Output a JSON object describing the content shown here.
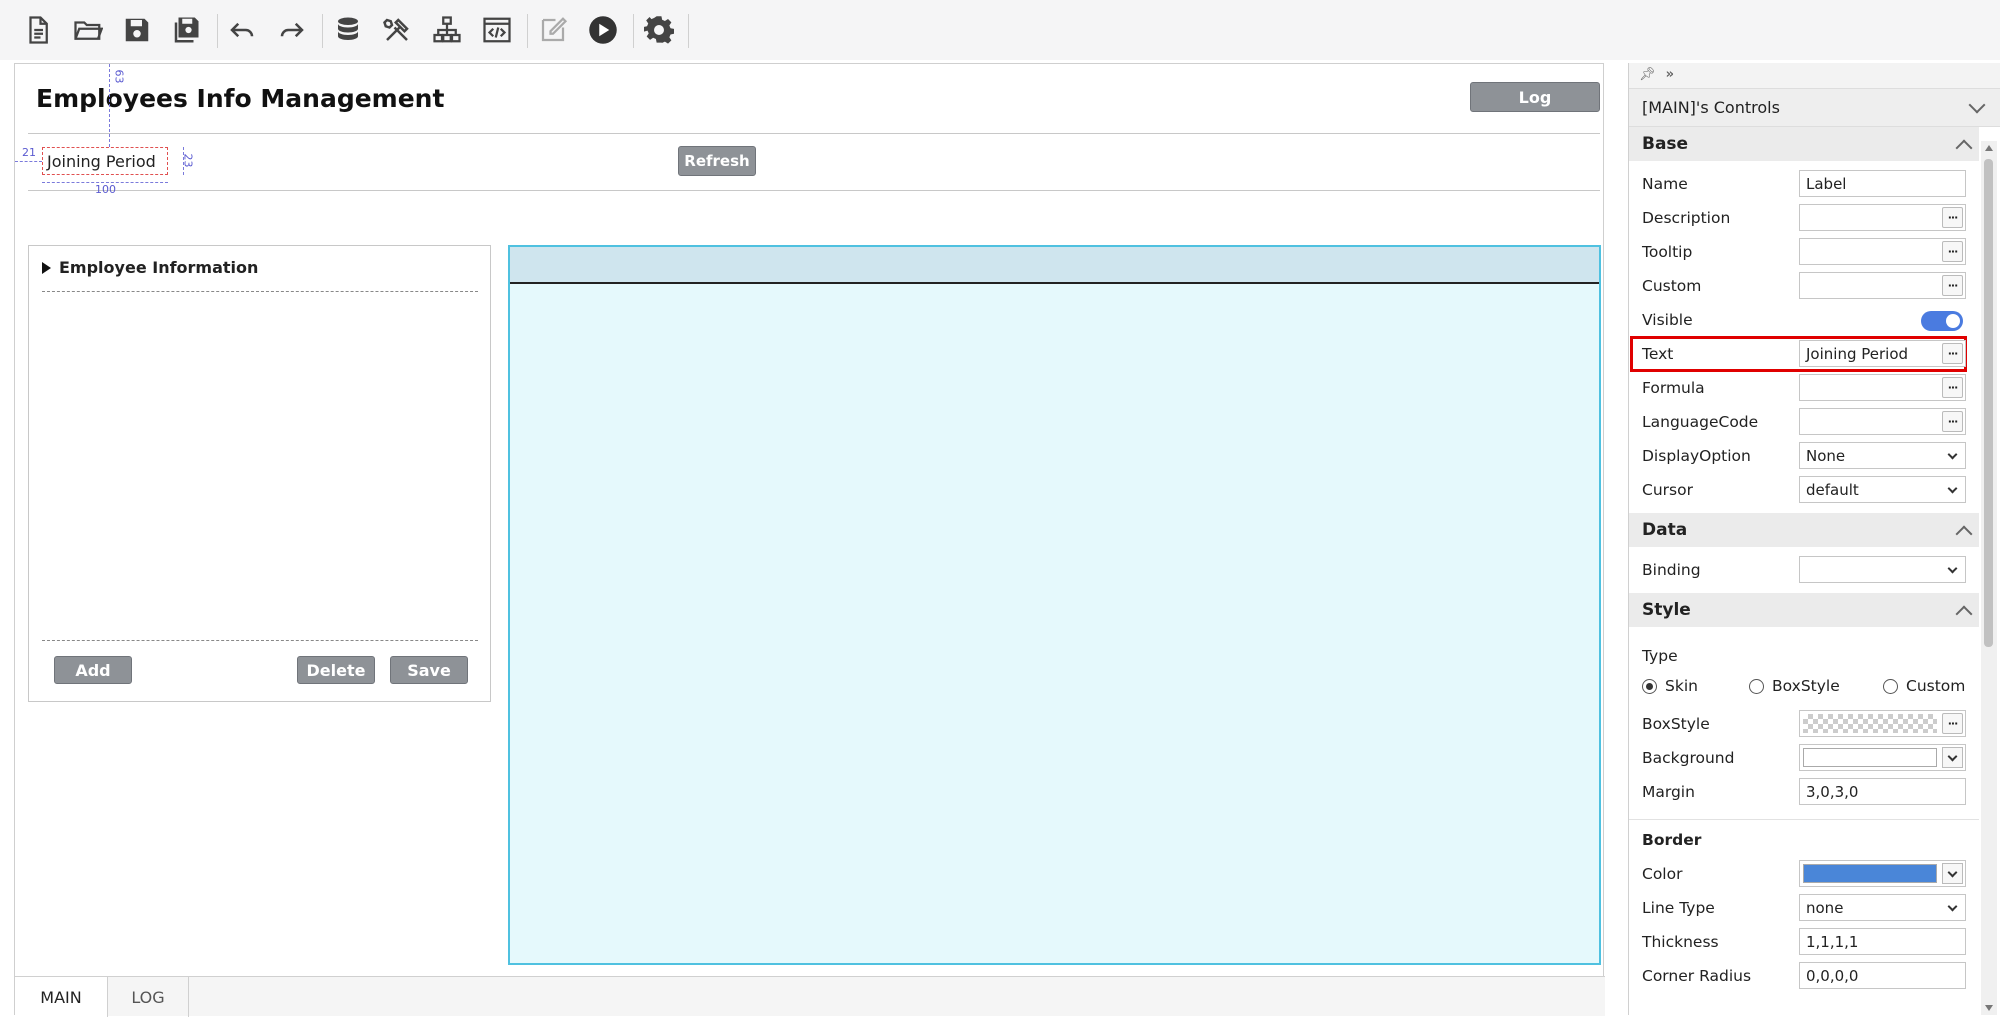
{
  "toolbar": {
    "icons": [
      "new-file-icon",
      "open-folder-icon",
      "save-icon",
      "save-all-icon",
      "undo-icon",
      "redo-icon",
      "database-icon",
      "tools-icon",
      "hierarchy-icon",
      "code-icon",
      "edit-icon",
      "play-icon",
      "gear-icon"
    ]
  },
  "canvas": {
    "title": "Employees Info Management",
    "log_button": "Log",
    "selected_label": "Joining Period",
    "guides": {
      "top": "63",
      "left": "21",
      "height": "23",
      "width": "100"
    },
    "refresh_button": "Refresh",
    "employee_panel": {
      "header": "Employee Information",
      "add_button": "Add",
      "delete_button": "Delete",
      "save_button": "Save"
    },
    "tabs": [
      {
        "label": "MAIN",
        "active": true
      },
      {
        "label": "LOG",
        "active": false
      }
    ]
  },
  "panel": {
    "title": "[MAIN]'s Controls",
    "sections": {
      "base": "Base",
      "data": "Data",
      "style": "Style",
      "border": "Border"
    },
    "base": {
      "name_label": "Name",
      "name_value": "Label",
      "description_label": "Description",
      "tooltip_label": "Tooltip",
      "custom_label": "Custom",
      "visible_label": "Visible",
      "visible": true,
      "text_label": "Text",
      "text_value": "Joining Period",
      "formula_label": "Formula",
      "languagecode_label": "LanguageCode",
      "displayoption_label": "DisplayOption",
      "displayoption_value": "None",
      "cursor_label": "Cursor",
      "cursor_value": "default"
    },
    "data": {
      "binding_label": "Binding"
    },
    "style": {
      "type_label": "Type",
      "type_options": [
        "Skin",
        "BoxStyle",
        "Custom"
      ],
      "type_selected": "Skin",
      "boxstyle_label": "BoxStyle",
      "background_label": "Background",
      "margin_label": "Margin",
      "margin_value": "3,0,3,0"
    },
    "border": {
      "color_label": "Color",
      "color_value": "#4a86d8",
      "linetype_label": "Line Type",
      "linetype_value": "none",
      "thickness_label": "Thickness",
      "thickness_value": "1,1,1,1",
      "cornerradius_label": "Corner Radius",
      "cornerradius_value": "0,0,0,0"
    }
  },
  "colors": {
    "accent": "#4a7be0",
    "button_gray": "#8e9297",
    "grid_fill": "#e5f9fc",
    "grid_border": "#4fc1e0",
    "highlight": "#e00000"
  }
}
